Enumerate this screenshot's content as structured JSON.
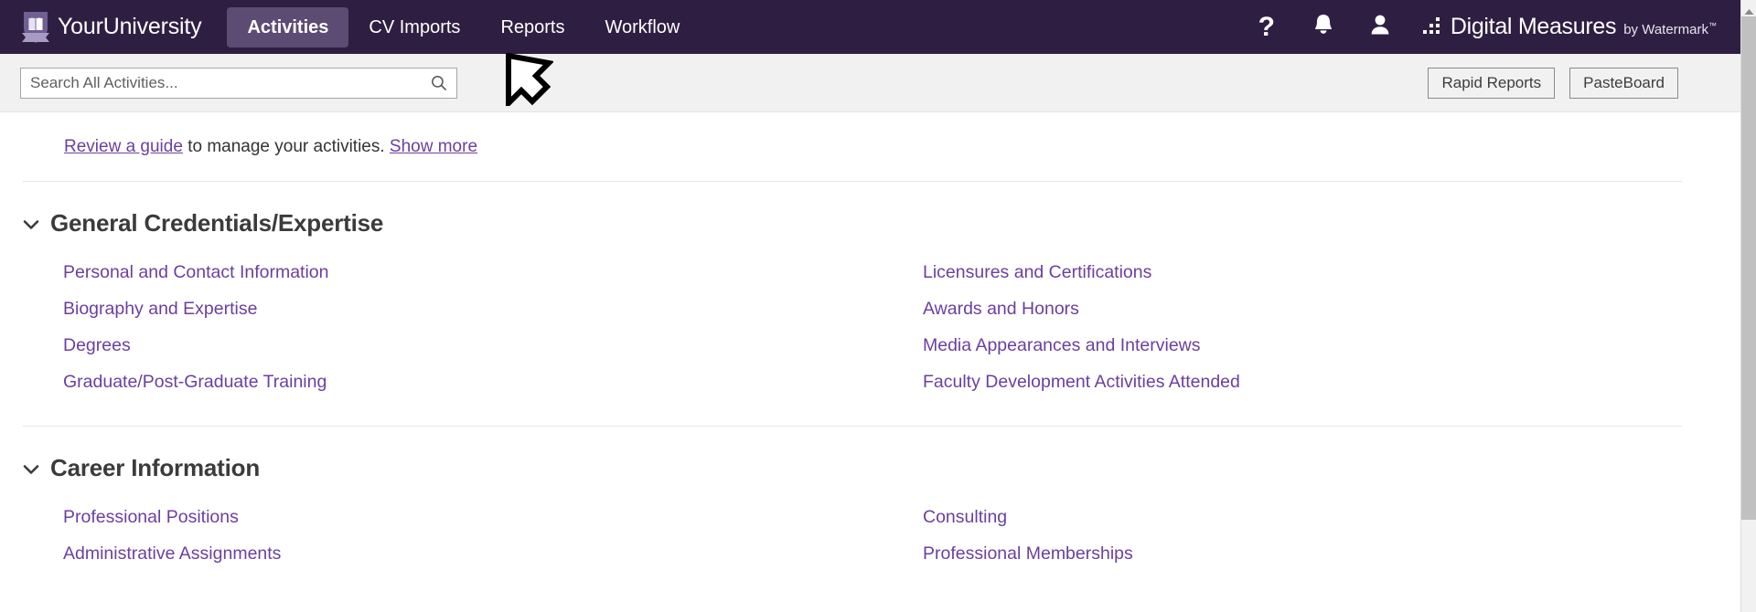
{
  "header": {
    "brand_name": "YourUniversity",
    "brand_icon": "shield-book-icon",
    "nav_items": [
      {
        "label": "Activities",
        "active": true
      },
      {
        "label": "CV Imports",
        "active": false
      },
      {
        "label": "Reports",
        "active": false
      },
      {
        "label": "Workflow",
        "active": false
      }
    ],
    "actions": [
      {
        "icon": "help-question-icon",
        "label": "?"
      },
      {
        "icon": "bell-notification-icon",
        "label": ""
      },
      {
        "icon": "user-profile-icon",
        "label": ""
      }
    ],
    "product_logo": {
      "icon": "digital-measures-dots-icon",
      "title": "Digital Measures",
      "subtitle": "by Watermark",
      "trademark": "™"
    },
    "colors": {
      "nav_background": "#2e1f42",
      "nav_active": "#5c4b73",
      "link_purple": "#6b3fa0"
    }
  },
  "toolbar": {
    "search_placeholder": "Search All Activities...",
    "search_value": "",
    "search_icon": "search-icon",
    "rapid_reports_label": "Rapid Reports",
    "pasteboard_label": "PasteBoard"
  },
  "guide": {
    "link_text": "Review a guide",
    "middle_text": " to manage your activities. ",
    "show_more_text": "Show more"
  },
  "sections": [
    {
      "title": "General Credentials/Expertise",
      "expanded": true,
      "chevron": "chevron-down-icon",
      "left_links": [
        "Personal and Contact Information",
        "Biography and Expertise",
        "Degrees",
        "Graduate/Post-Graduate Training"
      ],
      "right_links": [
        "Licensures and Certifications",
        "Awards and Honors",
        "Media Appearances and Interviews",
        "Faculty Development Activities Attended"
      ]
    },
    {
      "title": "Career Information",
      "expanded": true,
      "chevron": "chevron-down-icon",
      "left_links": [
        "Professional Positions",
        "Administrative Assignments"
      ],
      "right_links": [
        "Consulting",
        "Professional Memberships"
      ]
    }
  ],
  "scrollbar": {
    "up_arrow_icon": "scroll-up-arrow-icon",
    "thumb": "scrollbar-thumb"
  },
  "cursor": {
    "icon": "mouse-cursor-arrow-icon"
  }
}
